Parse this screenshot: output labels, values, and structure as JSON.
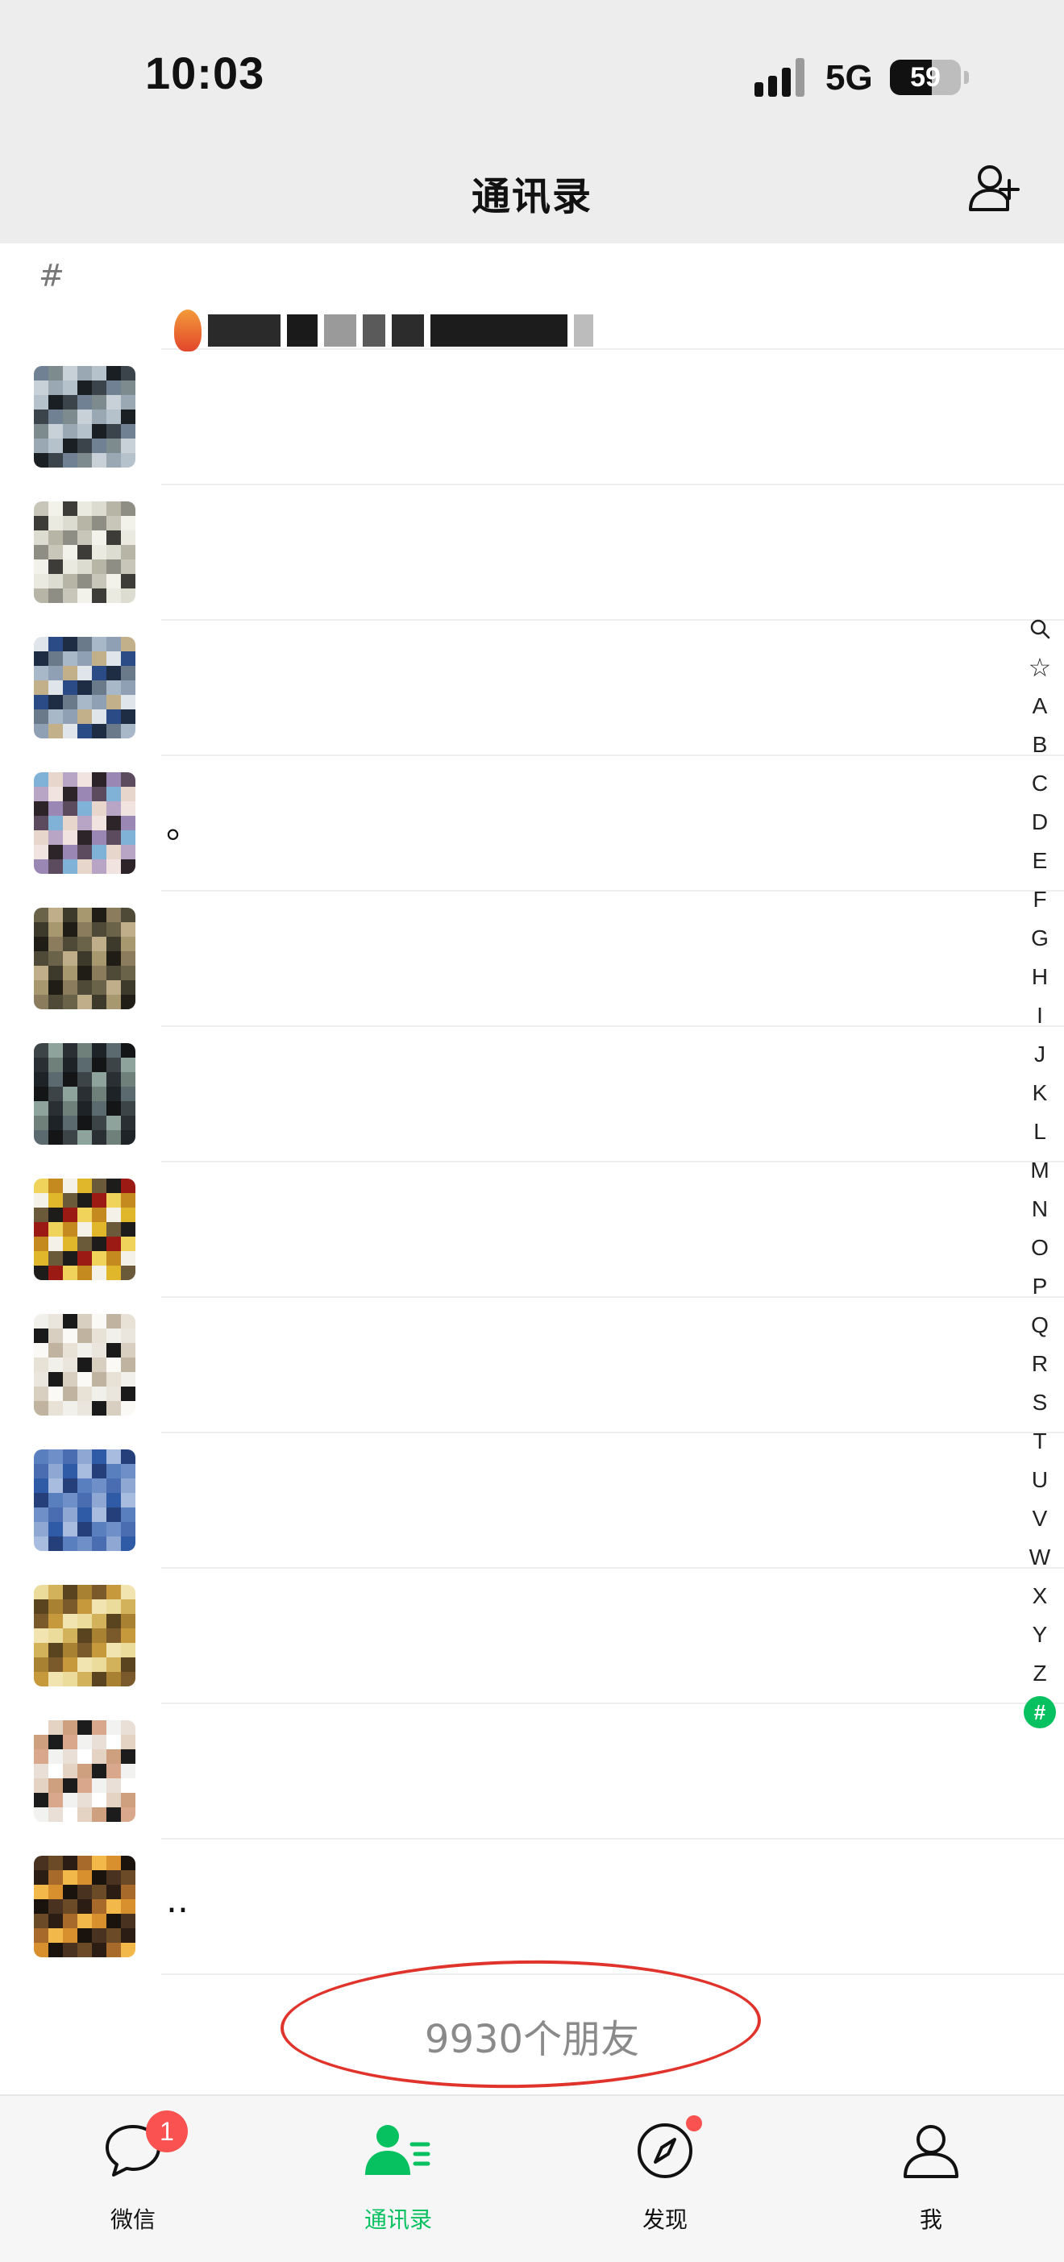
{
  "status_bar": {
    "time": "10:03",
    "network": "5G",
    "battery_level": "59",
    "battery_fraction": 0.59
  },
  "nav": {
    "title": "通讯录",
    "add_icon": "add-contact-icon"
  },
  "list": {
    "section_header": "#",
    "contacts": [
      {
        "name": "",
        "palette": [
          "#6f8193",
          "#9aa8b4",
          "#3b434b",
          "#c9d1d8",
          "#1a1f24",
          "#7d8b8f",
          "#b5c2cc"
        ]
      },
      {
        "name": "",
        "palette": [
          "#dcdcd0",
          "#c7c6b8",
          "#ebeae0",
          "#8f8e84",
          "#3d3c38",
          "#b7b6a6",
          "#f2f1ea"
        ]
      },
      {
        "name": "",
        "palette": [
          "#2b4b86",
          "#a9b8c9",
          "#dfe5ea",
          "#6b7a8a",
          "#c2b08a",
          "#1e2c44",
          "#8fa0b5"
        ]
      },
      {
        "name": "。",
        "palette": [
          "#9a87b3",
          "#e6d6cc",
          "#2c2428",
          "#7fb2d6",
          "#f1e3df",
          "#5c4a5e",
          "#b8a5c6"
        ]
      },
      {
        "name": "",
        "palette": [
          "#3d3a2b",
          "#8c7c5e",
          "#c0ae8b",
          "#1f1d16",
          "#6b624a",
          "#a8986f",
          "#4e4a37"
        ]
      },
      {
        "name": "",
        "palette": [
          "#141516",
          "#2a2f33",
          "#5a6a6e",
          "#8ea39c",
          "#1d2326",
          "#3c4448",
          "#6f7f7a"
        ]
      },
      {
        "name": "",
        "palette": [
          "#e0b62a",
          "#9b1a14",
          "#f4f1e8",
          "#1d1c1a",
          "#c48a20",
          "#6a5a3a",
          "#efd35a"
        ]
      },
      {
        "name": "",
        "palette": [
          "#f2f0ea",
          "#d8cfc0",
          "#e7e1d6",
          "#1a1a1a",
          "#c0b4a0",
          "#ebe6dd",
          "#faf9f5"
        ]
      },
      {
        "name": "",
        "palette": [
          "#2f5aa6",
          "#5a7fbf",
          "#8ea7d3",
          "#243f7a",
          "#4a6db2",
          "#a8bce0",
          "#6f8fc8"
        ]
      },
      {
        "name": "",
        "palette": [
          "#d2b25a",
          "#7a5a2a",
          "#ebdc9c",
          "#a88232",
          "#f1e4b0",
          "#5a4420",
          "#c69a3c"
        ]
      },
      {
        "name": "",
        "palette": [
          "#f2f2f0",
          "#e4d2c2",
          "#d9a88c",
          "#ffffff",
          "#1c1c1c",
          "#e9dfd6",
          "#cfa080"
        ]
      },
      {
        "name": "..",
        "palette": [
          "#2b1d14",
          "#d8902e",
          "#6b4a28",
          "#f2b94a",
          "#4a3220",
          "#a86a2a",
          "#1a120c"
        ]
      }
    ]
  },
  "index_bar": [
    "search-icon",
    "star-icon",
    "A",
    "B",
    "C",
    "D",
    "E",
    "F",
    "G",
    "H",
    "I",
    "J",
    "K",
    "L",
    "M",
    "N",
    "O",
    "P",
    "Q",
    "R",
    "S",
    "T",
    "U",
    "V",
    "W",
    "X",
    "Y",
    "Z",
    "#"
  ],
  "index_active": "#",
  "footer": {
    "friend_count": "9930个朋友"
  },
  "tabs": [
    {
      "label": "微信",
      "icon": "chat-bubble-icon",
      "badge": "1"
    },
    {
      "label": "通讯录",
      "icon": "contacts-icon",
      "active": true
    },
    {
      "label": "发现",
      "icon": "compass-icon",
      "dot": true
    },
    {
      "label": "我",
      "icon": "person-icon"
    }
  ],
  "colors": {
    "accent": "#07c160",
    "badge": "#fa5151",
    "bar_bg": "#ededed",
    "annotation": "#e0332c"
  }
}
